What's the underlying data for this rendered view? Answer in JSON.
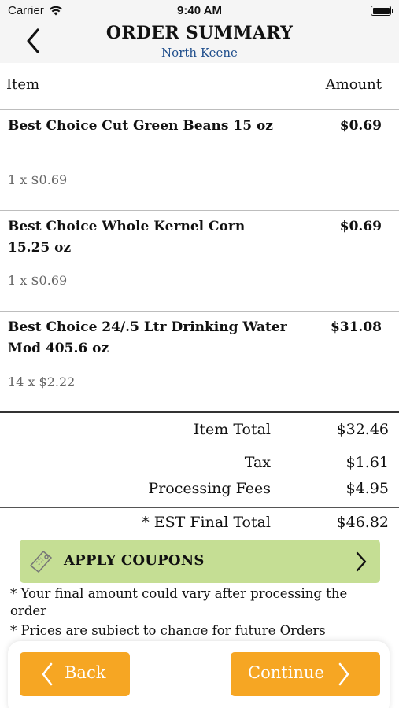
{
  "status_bar": {
    "carrier": "Carrier",
    "time": "9:40 AM",
    "icons": [
      "wifi-icon",
      "battery-icon"
    ]
  },
  "header": {
    "title": "ORDER SUMMARY",
    "subtitle": "North Keene",
    "back_icon": "chevron-left-icon"
  },
  "table": {
    "col_item": "Item",
    "col_amount": "Amount"
  },
  "items": [
    {
      "name": "Best Choice Cut Green Beans 15 oz",
      "qty": "1 x $0.69",
      "price": "$0.69"
    },
    {
      "name": "Best Choice Whole Kernel Corn 15.25 oz",
      "qty": "1 x $0.69",
      "price": "$0.69"
    },
    {
      "name": "Best Choice 24/.5 Ltr Drinking Water Mod 405.6 oz",
      "qty": "14 x $2.22",
      "price": "$31.08"
    }
  ],
  "totals": {
    "item_total_label": "Item Total",
    "item_total": "$32.46",
    "tax_label": "Tax",
    "tax": "$1.61",
    "fees_label": "Processing Fees",
    "fees": "$4.95",
    "final_label": "* EST Final Total",
    "final": "$46.82"
  },
  "coupon": {
    "label": "APPLY COUPONS",
    "icon": "coupon-tag-icon",
    "color": "#c5de94"
  },
  "notes": {
    "note1": "* Your final amount could vary  after processing the order",
    "note2": "* Prices are subject to change  for future Orders"
  },
  "footer": {
    "back_label": "Back",
    "continue_label": "Continue",
    "button_color": "#f6a623"
  },
  "colors": {
    "subtitle": "#1f4e8c",
    "header_bg": "#f5f5f5"
  }
}
